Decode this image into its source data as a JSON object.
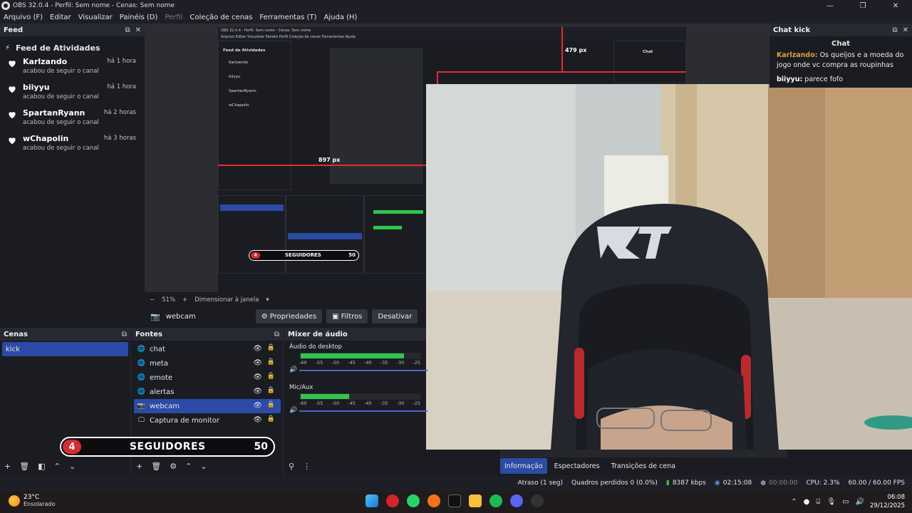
{
  "window": {
    "title": "OBS 32.0.4 - Perfil: Sem nome - Cenas: Sem nome"
  },
  "menu": [
    "Arquivo (F)",
    "Editar",
    "Visualizar",
    "Painéis (D)",
    "Perfil",
    "Coleção de cenas",
    "Ferramentas (T)",
    "Ajuda (H)"
  ],
  "feed": {
    "dock_title": "Feed",
    "header": "Feed de Atividades",
    "items": [
      {
        "name": "Karlzando",
        "desc": "acabou de seguir o canal",
        "time": "há 1 hora"
      },
      {
        "name": "biiyyu",
        "desc": "acabou de seguir o canal",
        "time": "há 1 hora"
      },
      {
        "name": "SpartanRyann",
        "desc": "acabou de seguir o canal",
        "time": "há 2 horas"
      },
      {
        "name": "wChapolin",
        "desc": "acabou de seguir o canal",
        "time": "há 3 horas"
      }
    ]
  },
  "chat": {
    "dock_title": "Chat kick",
    "header": "Chat",
    "messages": [
      {
        "user": "Karlzando:",
        "text": " Os queijos e a moeda do jogo onde vc compra as roupinhas"
      },
      {
        "user": "biiyyu:",
        "text": " parece fofo"
      }
    ]
  },
  "preview": {
    "measure_right": "479 px",
    "measure_left": "897 px",
    "nested_title": "OBS 32.0.4 - Perfil: Sem nome - Cenas: Sem nome",
    "nested_feed_header": "Feed de Atividades",
    "nested_seg_label": "SEGUIDORES",
    "nested_seg_count": "4",
    "nested_seg_goal": "50"
  },
  "zoom": {
    "minus": "−",
    "level": "51%",
    "plus": "+",
    "mode": "Dimensionar à janela"
  },
  "source_toolbar": {
    "source_name": "webcam",
    "properties": "Propriedades",
    "filters": "Filtros",
    "deactivate": "Desativar"
  },
  "scenes": {
    "title": "Cenas",
    "items": [
      "kick"
    ]
  },
  "sources": {
    "title": "Fontes",
    "items": [
      {
        "name": "chat",
        "icon": "globe"
      },
      {
        "name": "meta",
        "icon": "globe"
      },
      {
        "name": "emote",
        "icon": "globe"
      },
      {
        "name": "alertas",
        "icon": "globe"
      },
      {
        "name": "webcam",
        "icon": "camera",
        "selected": true
      },
      {
        "name": "Captura de monitor",
        "icon": "monitor"
      }
    ]
  },
  "mixer": {
    "title": "Mixer de áudio",
    "channels": [
      {
        "label": "Áudio do desktop",
        "level": 0.85
      },
      {
        "label": "Mic/Aux",
        "level": 0.4
      }
    ],
    "scale": [
      "-60",
      "-55",
      "-50",
      "-45",
      "-40",
      "-35",
      "-30",
      "-25"
    ]
  },
  "seguidores": {
    "count": "4",
    "label": "SEGUIDORES",
    "goal": "50"
  },
  "bottom_tabs": [
    "Informação",
    "Espectadores",
    "Transições de cena"
  ],
  "status": {
    "delay": "Atraso (1 seg)",
    "dropped": "Quadros perdidos 0 (0.0%)",
    "bitrate": "8387 kbps",
    "stream_time": "02:15:08",
    "rec_time": "00:00:00",
    "cpu": "CPU: 2.3%",
    "fps": "60.00 / 60.00 FPS"
  },
  "taskbar": {
    "temp": "23°C",
    "weather": "Ensolarado",
    "time": "06:08",
    "date": "29/12/2025"
  },
  "colors": {
    "accent": "#2c4aa6",
    "red": "#e22c34",
    "meter": "#2ec64e"
  }
}
